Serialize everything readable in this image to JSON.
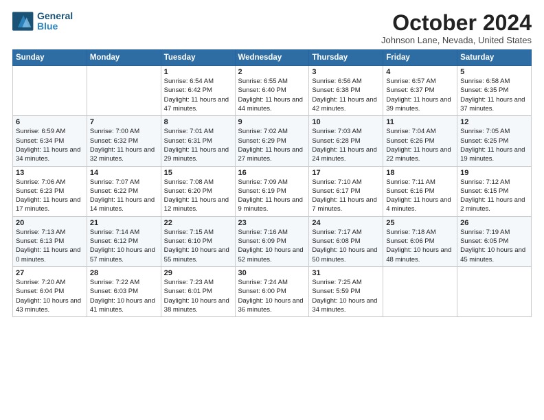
{
  "header": {
    "logo_line1": "General",
    "logo_line2": "Blue",
    "month": "October 2024",
    "location": "Johnson Lane, Nevada, United States"
  },
  "weekdays": [
    "Sunday",
    "Monday",
    "Tuesday",
    "Wednesday",
    "Thursday",
    "Friday",
    "Saturday"
  ],
  "weeks": [
    [
      {
        "day": "",
        "content": ""
      },
      {
        "day": "",
        "content": ""
      },
      {
        "day": "1",
        "content": "Sunrise: 6:54 AM\nSunset: 6:42 PM\nDaylight: 11 hours and 47 minutes."
      },
      {
        "day": "2",
        "content": "Sunrise: 6:55 AM\nSunset: 6:40 PM\nDaylight: 11 hours and 44 minutes."
      },
      {
        "day": "3",
        "content": "Sunrise: 6:56 AM\nSunset: 6:38 PM\nDaylight: 11 hours and 42 minutes."
      },
      {
        "day": "4",
        "content": "Sunrise: 6:57 AM\nSunset: 6:37 PM\nDaylight: 11 hours and 39 minutes."
      },
      {
        "day": "5",
        "content": "Sunrise: 6:58 AM\nSunset: 6:35 PM\nDaylight: 11 hours and 37 minutes."
      }
    ],
    [
      {
        "day": "6",
        "content": "Sunrise: 6:59 AM\nSunset: 6:34 PM\nDaylight: 11 hours and 34 minutes."
      },
      {
        "day": "7",
        "content": "Sunrise: 7:00 AM\nSunset: 6:32 PM\nDaylight: 11 hours and 32 minutes."
      },
      {
        "day": "8",
        "content": "Sunrise: 7:01 AM\nSunset: 6:31 PM\nDaylight: 11 hours and 29 minutes."
      },
      {
        "day": "9",
        "content": "Sunrise: 7:02 AM\nSunset: 6:29 PM\nDaylight: 11 hours and 27 minutes."
      },
      {
        "day": "10",
        "content": "Sunrise: 7:03 AM\nSunset: 6:28 PM\nDaylight: 11 hours and 24 minutes."
      },
      {
        "day": "11",
        "content": "Sunrise: 7:04 AM\nSunset: 6:26 PM\nDaylight: 11 hours and 22 minutes."
      },
      {
        "day": "12",
        "content": "Sunrise: 7:05 AM\nSunset: 6:25 PM\nDaylight: 11 hours and 19 minutes."
      }
    ],
    [
      {
        "day": "13",
        "content": "Sunrise: 7:06 AM\nSunset: 6:23 PM\nDaylight: 11 hours and 17 minutes."
      },
      {
        "day": "14",
        "content": "Sunrise: 7:07 AM\nSunset: 6:22 PM\nDaylight: 11 hours and 14 minutes."
      },
      {
        "day": "15",
        "content": "Sunrise: 7:08 AM\nSunset: 6:20 PM\nDaylight: 11 hours and 12 minutes."
      },
      {
        "day": "16",
        "content": "Sunrise: 7:09 AM\nSunset: 6:19 PM\nDaylight: 11 hours and 9 minutes."
      },
      {
        "day": "17",
        "content": "Sunrise: 7:10 AM\nSunset: 6:17 PM\nDaylight: 11 hours and 7 minutes."
      },
      {
        "day": "18",
        "content": "Sunrise: 7:11 AM\nSunset: 6:16 PM\nDaylight: 11 hours and 4 minutes."
      },
      {
        "day": "19",
        "content": "Sunrise: 7:12 AM\nSunset: 6:15 PM\nDaylight: 11 hours and 2 minutes."
      }
    ],
    [
      {
        "day": "20",
        "content": "Sunrise: 7:13 AM\nSunset: 6:13 PM\nDaylight: 11 hours and 0 minutes."
      },
      {
        "day": "21",
        "content": "Sunrise: 7:14 AM\nSunset: 6:12 PM\nDaylight: 10 hours and 57 minutes."
      },
      {
        "day": "22",
        "content": "Sunrise: 7:15 AM\nSunset: 6:10 PM\nDaylight: 10 hours and 55 minutes."
      },
      {
        "day": "23",
        "content": "Sunrise: 7:16 AM\nSunset: 6:09 PM\nDaylight: 10 hours and 52 minutes."
      },
      {
        "day": "24",
        "content": "Sunrise: 7:17 AM\nSunset: 6:08 PM\nDaylight: 10 hours and 50 minutes."
      },
      {
        "day": "25",
        "content": "Sunrise: 7:18 AM\nSunset: 6:06 PM\nDaylight: 10 hours and 48 minutes."
      },
      {
        "day": "26",
        "content": "Sunrise: 7:19 AM\nSunset: 6:05 PM\nDaylight: 10 hours and 45 minutes."
      }
    ],
    [
      {
        "day": "27",
        "content": "Sunrise: 7:20 AM\nSunset: 6:04 PM\nDaylight: 10 hours and 43 minutes."
      },
      {
        "day": "28",
        "content": "Sunrise: 7:22 AM\nSunset: 6:03 PM\nDaylight: 10 hours and 41 minutes."
      },
      {
        "day": "29",
        "content": "Sunrise: 7:23 AM\nSunset: 6:01 PM\nDaylight: 10 hours and 38 minutes."
      },
      {
        "day": "30",
        "content": "Sunrise: 7:24 AM\nSunset: 6:00 PM\nDaylight: 10 hours and 36 minutes."
      },
      {
        "day": "31",
        "content": "Sunrise: 7:25 AM\nSunset: 5:59 PM\nDaylight: 10 hours and 34 minutes."
      },
      {
        "day": "",
        "content": ""
      },
      {
        "day": "",
        "content": ""
      }
    ]
  ]
}
